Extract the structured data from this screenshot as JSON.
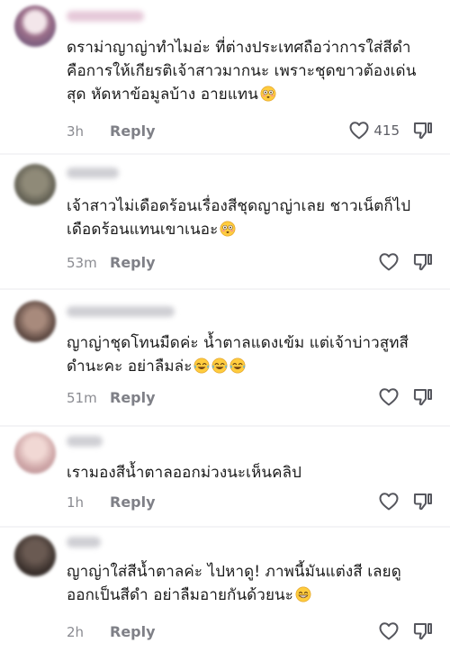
{
  "comments": [
    {
      "line1": "ดราม่าญาญ่าทำไมอ่ะ ที่ต่างประเทศถือว่าการใส่สีดำ",
      "line2": "คือการให้เกียรติเจ้าสาวมากนะ เพราะชุดขาวต้องเด่น",
      "line3": "สุด หัดหาข้อมูลบ้าง อายแทน",
      "emoji": "flushed-face-icon",
      "time": "3h",
      "reply": "Reply",
      "likes": "415"
    },
    {
      "line1": "เจ้าสาวไม่เดือดร้อนเรื่องสีชุดญาญ่าเลย ชาวเน็ตก็ไป",
      "line2": "เดือดร้อนแทนเขาเนอะ",
      "emoji": "flushed-face-icon",
      "time": "53m",
      "reply": "Reply"
    },
    {
      "line1": "ญาญ่าชุดโทนมืดค่ะ น้ำตาลแดงเข้ม แต่เจ้าบ่าวสูทสี",
      "line2": "ดำนะคะ อย่าลืมล่ะ",
      "emoji": "tears-of-joy-icon",
      "time": "51m",
      "reply": "Reply"
    },
    {
      "line1": "เรามองสีน้ำตาลออกม่วงนะเห็นคลิป",
      "time": "1h",
      "reply": "Reply"
    },
    {
      "line1": "ญาญ่าใส่สีน้ำตาลค่ะ ไปหาดู! ภาพนี้มันแต่งสี เลยดู",
      "line2": "ออกเป็นสีดำ อย่าลืมอายกันด้วยนะ",
      "emoji": "grinning-face-icon",
      "time": "2h",
      "reply": "Reply"
    }
  ]
}
